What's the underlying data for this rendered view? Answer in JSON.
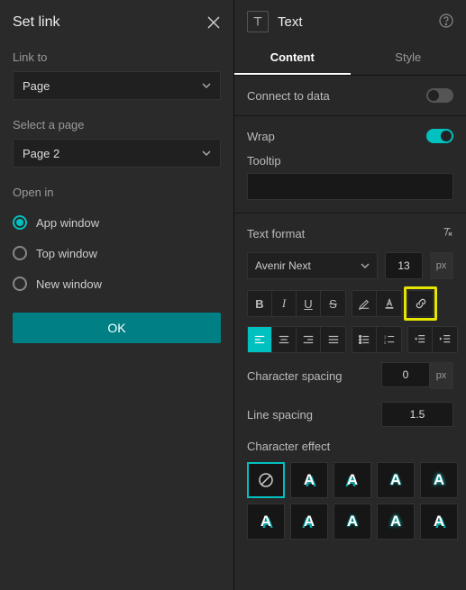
{
  "leftPanel": {
    "title": "Set link",
    "linkToLabel": "Link to",
    "linkToValue": "Page",
    "selectPageLabel": "Select a page",
    "selectPageValue": "Page 2",
    "openInLabel": "Open in",
    "radios": {
      "appWindow": "App window",
      "topWindow": "Top window",
      "newWindow": "New window"
    },
    "okLabel": "OK"
  },
  "rightPanel": {
    "widgetName": "Text",
    "tabs": {
      "content": "Content",
      "style": "Style"
    },
    "connectLabel": "Connect to data",
    "wrapLabel": "Wrap",
    "tooltipLabel": "Tooltip",
    "textFormatLabel": "Text format",
    "fontName": "Avenir Next",
    "fontSize": "13",
    "fontUnit": "px",
    "charSpacingLabel": "Character spacing",
    "charSpacingValue": "0",
    "charSpacingUnit": "px",
    "lineSpacingLabel": "Line spacing",
    "lineSpacingValue": "1.5",
    "charEffectLabel": "Character effect",
    "effectLetter": "A"
  }
}
